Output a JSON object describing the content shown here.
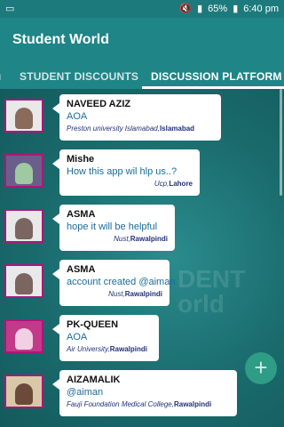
{
  "status_bar": {
    "battery": "65%",
    "time": "6:40 pm"
  },
  "app": {
    "title": "Student World"
  },
  "tabs": [
    {
      "label": ""
    },
    {
      "label": "STUDENT DISCOUNTS"
    },
    {
      "label": "DISCUSSION PLATFORM"
    }
  ],
  "watermark": {
    "line1": "DENT",
    "line2": "orld"
  },
  "posts": [
    {
      "name": "NAVEED AZIZ",
      "message": "AOA",
      "place": "Preston university Islamabad,",
      "city": "Islamabad"
    },
    {
      "name": "Mishe",
      "message": "How this app wil hlp us..?",
      "place": "Ucp,",
      "city": "Lahore"
    },
    {
      "name": "ASMA",
      "message": "hope it will be helpful",
      "place": "Nust,",
      "city": "Rawalpindi"
    },
    {
      "name": "ASMA",
      "message": "account created @aiman",
      "place": "Nust,",
      "city": "Rawalpindi"
    },
    {
      "name": "PK-QUEEN",
      "message": "AOA",
      "place": "Air University,",
      "city": "Rawalpindi"
    },
    {
      "name": "AIZAMALIK",
      "message": "@aiman",
      "place": "Fauji Foundation Medical College,",
      "city": "Rawalpindi"
    }
  ],
  "fab": {
    "icon": "plus-icon",
    "glyph": "+"
  },
  "colors": {
    "primary": "#1f8587",
    "avatar_border": "#b0157a",
    "fab": "#2f9c86"
  }
}
